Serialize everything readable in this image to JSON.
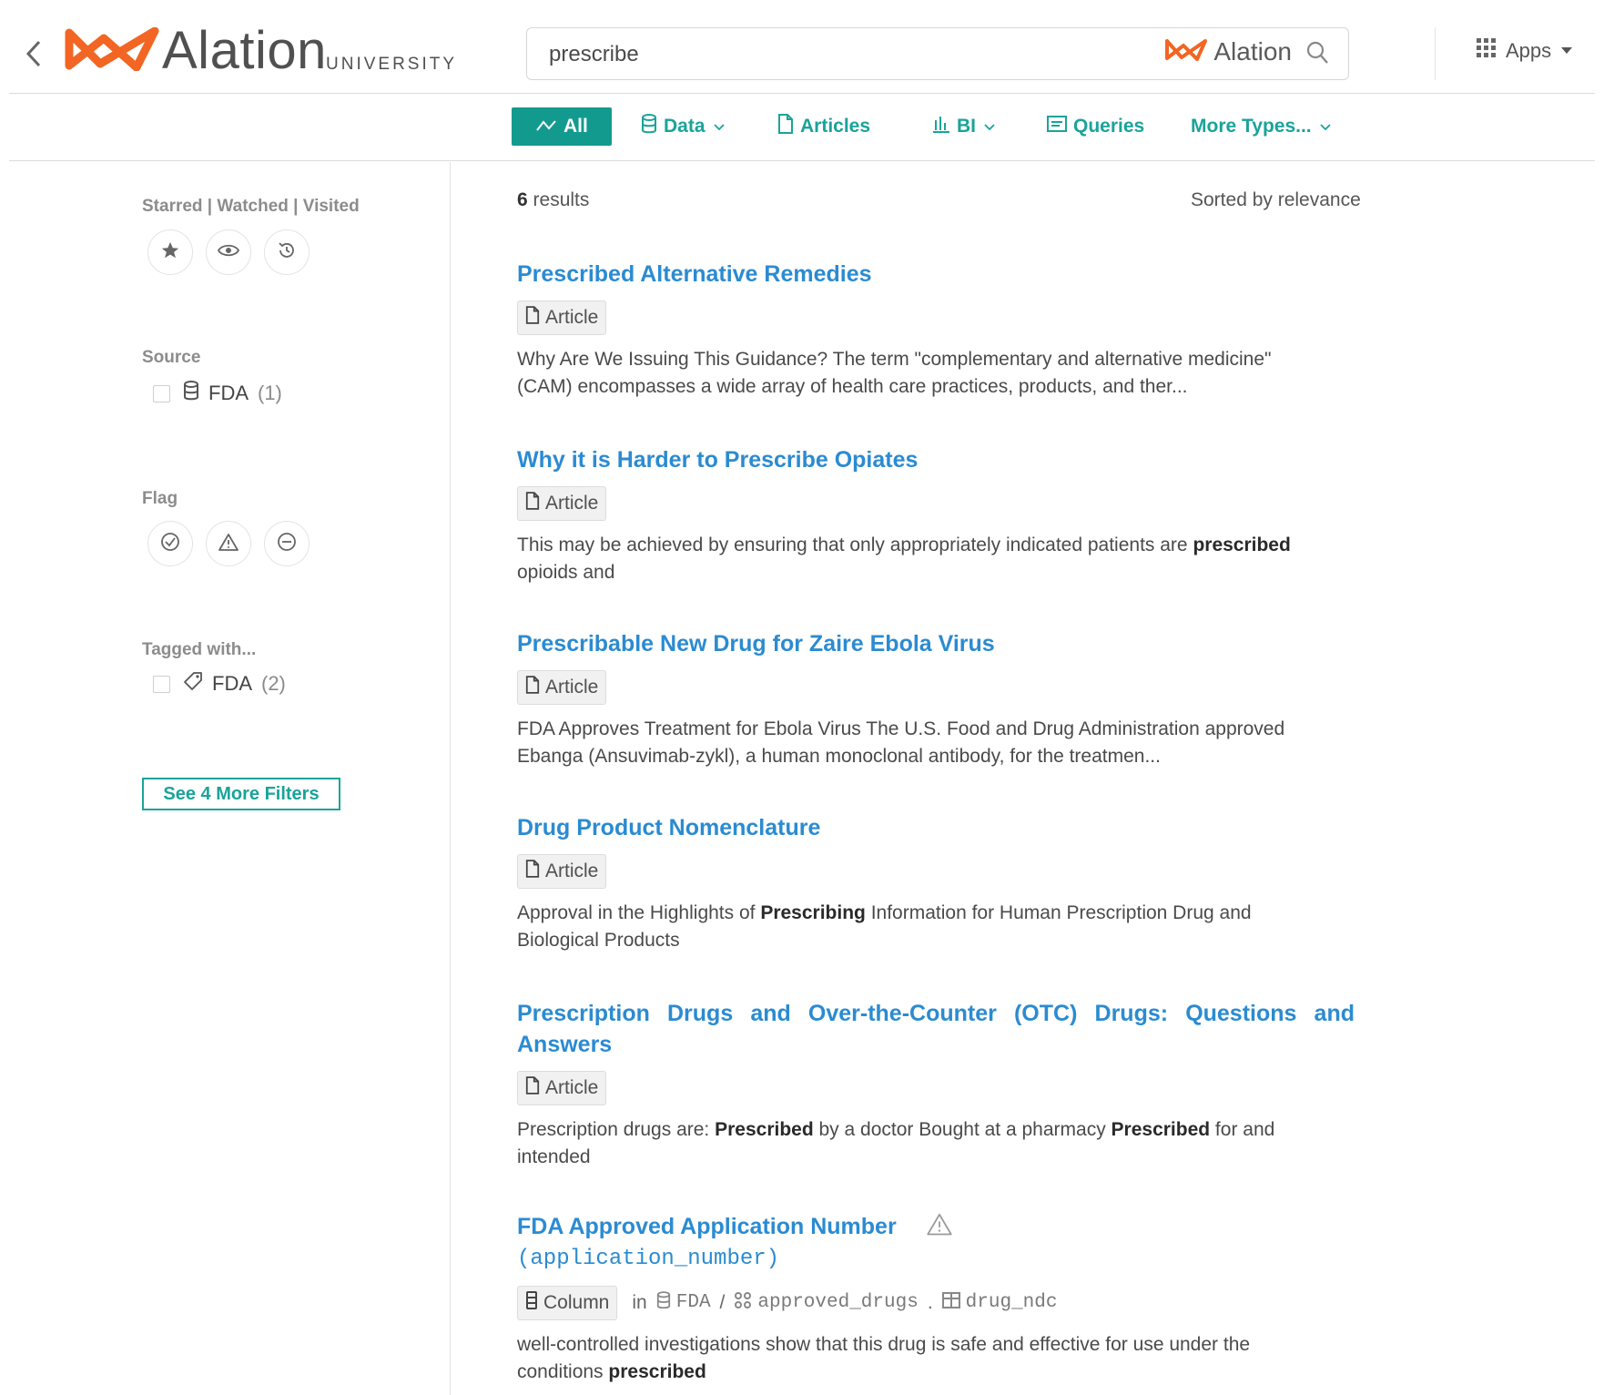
{
  "header": {
    "logo_text": "Alation",
    "logo_subtext": "UNIVERSITY",
    "search_value": "prescribe",
    "search_brand": "Alation",
    "apps_label": "Apps"
  },
  "tabs": [
    {
      "label": "All",
      "icon": "all-icon",
      "active": true
    },
    {
      "label": "Data",
      "icon": "database-icon",
      "dropdown": true
    },
    {
      "label": "Articles",
      "icon": "article-icon"
    },
    {
      "label": "BI",
      "icon": "bar-chart-icon",
      "dropdown": true
    },
    {
      "label": "Queries",
      "icon": "query-icon"
    },
    {
      "label": "More Types...",
      "dropdown": true
    }
  ],
  "sidebar": {
    "starred_heading": "Starred | Watched | Visited",
    "source_heading": "Source",
    "source_option": {
      "label": "FDA",
      "count": "(1)"
    },
    "flag_heading": "Flag",
    "tagged_heading": "Tagged with...",
    "tag_option": {
      "label": "FDA",
      "count": "(2)"
    },
    "more_filters": "See 4 More Filters"
  },
  "results_header": {
    "count": "6",
    "count_suffix": " results",
    "sorted": "Sorted by relevance"
  },
  "results": [
    {
      "title": "Prescribed Alternative Remedies",
      "type": "Article",
      "snippet_1": "Why Are We Issuing This Guidance? The term \"complementary and alternative medicine\"",
      "snippet_2": "(CAM) encompasses a wide array of health care practices, products, and ther..."
    },
    {
      "title": "Why it is Harder to Prescribe Opiates",
      "type": "Article",
      "snippet_a": "This may be achieved by ensuring that only appropriately indicated patients are ",
      "snippet_b": "prescribed",
      "snippet_c": "opioids and"
    },
    {
      "title": "Prescribable New Drug for Zaire Ebola Virus",
      "type": "Article",
      "snippet_1": "FDA Approves Treatment for Ebola Virus   The U.S. Food and Drug Administration approved",
      "snippet_2": "Ebanga (Ansuvimab-zykl), a human monoclonal antibody, for the treatmen..."
    },
    {
      "title": "Drug Product Nomenclature",
      "type": "Article",
      "snippet_a": "Approval in the Highlights of ",
      "snippet_b": "Prescribing",
      "snippet_c": " Information for Human Prescription Drug and",
      "snippet_d": "Biological Products"
    },
    {
      "title": "Prescription Drugs and Over-the-Counter (OTC) Drugs: Questions and Answers",
      "type": "Article",
      "snippet_a": "Prescription drugs are: ",
      "snippet_b": "Prescribed",
      "snippet_c": " by a doctor Bought at a pharmacy ",
      "snippet_d": "Prescribed",
      "snippet_e": " for and",
      "snippet_f": "intended"
    },
    {
      "title": "FDA Approved Application Number",
      "subtitle": "(application_number)",
      "type": "Column",
      "in_label": "in",
      "path_source": "FDA",
      "path_sep1": "/",
      "path_schema": "approved_drugs",
      "path_sep2": ".",
      "path_table": "drug_ndc",
      "snippet_a": "well-controlled investigations show that this drug is safe and effective for use under the",
      "snippet_b": "conditions ",
      "snippet_c": "prescribed"
    }
  ],
  "colors": {
    "accent": "#1aa39a",
    "active_tab": "#139a8f",
    "link": "#2b8bd1",
    "logo_orange": "#f26522"
  }
}
